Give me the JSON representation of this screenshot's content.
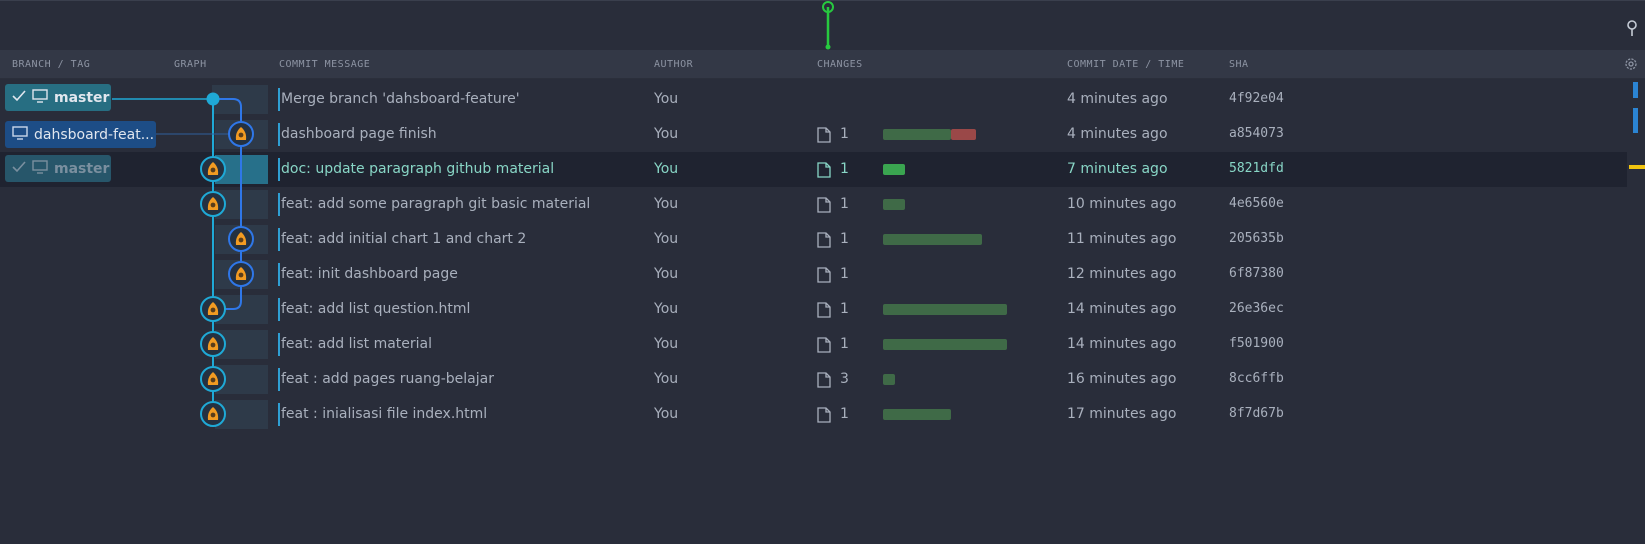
{
  "header": {
    "branch_tag": "BRANCH / TAG",
    "graph": "GRAPH",
    "commit_message": "COMMIT MESSAGE",
    "author": "AUTHOR",
    "changes": "CHANGES",
    "commit_date": "COMMIT DATE / TIME",
    "sha": "SHA"
  },
  "branches": {
    "master": "master",
    "feature": "dahsboard-feat...",
    "master_remote": "master"
  },
  "commits": [
    {
      "message": "Merge branch 'dahsboard-feature'",
      "author": "You",
      "files": "",
      "added": 0,
      "deleted": 0,
      "date": "4 minutes ago",
      "sha": "4f92e04"
    },
    {
      "message": "dashboard page finish",
      "author": "You",
      "files": "1",
      "added": 0.55,
      "deleted": 0.2,
      "date": "4 minutes ago",
      "sha": "a854073"
    },
    {
      "message": "doc: update paragraph github material",
      "author": "You",
      "files": "1",
      "added": 0.18,
      "deleted": 0,
      "date": "7 minutes ago",
      "sha": "5821dfd"
    },
    {
      "message": "feat: add some paragraph git basic material",
      "author": "You",
      "files": "1",
      "added": 0.18,
      "deleted": 0,
      "date": "10 minutes ago",
      "sha": "4e6560e"
    },
    {
      "message": "feat: add initial chart 1 and chart 2",
      "author": "You",
      "files": "1",
      "added": 0.8,
      "deleted": 0,
      "date": "11 minutes ago",
      "sha": "205635b"
    },
    {
      "message": "feat: init dashboard page",
      "author": "You",
      "files": "1",
      "added": 0,
      "deleted": 0,
      "date": "12 minutes ago",
      "sha": "6f87380"
    },
    {
      "message": "feat: add list question.html",
      "author": "You",
      "files": "1",
      "added": 1.0,
      "deleted": 0,
      "date": "14 minutes ago",
      "sha": "26e36ec"
    },
    {
      "message": "feat: add list material",
      "author": "You",
      "files": "1",
      "added": 1.0,
      "deleted": 0,
      "date": "14 minutes ago",
      "sha": "f501900"
    },
    {
      "message": "feat : add pages ruang-belajar",
      "author": "You",
      "files": "3",
      "added": 0.1,
      "deleted": 0,
      "date": "16 minutes ago",
      "sha": "8cc6ffb"
    },
    {
      "message": "feat : inialisasi file index.html",
      "author": "You",
      "files": "1",
      "added": 0.55,
      "deleted": 0,
      "date": "17 minutes ago",
      "sha": "8f7d67b"
    }
  ],
  "selected_index": 2,
  "colors": {
    "background": "#292d3a",
    "header": "#333846",
    "selected_row": "#1f2330",
    "selected_text": "#88d6c6",
    "graph_main": "#1fa9d6",
    "graph_feature": "#2f77e8",
    "bar_added": "#3f6a47",
    "bar_deleted": "#9a4848",
    "marker_green": "#27c93f",
    "marker_yellow": "#f1c40f"
  },
  "icons": {
    "checkmark": "check-icon",
    "computer": "monitor-icon",
    "file": "file-icon",
    "settings": "gear-icon",
    "commit": "commit-icon",
    "avatar": "avatar-icon"
  }
}
